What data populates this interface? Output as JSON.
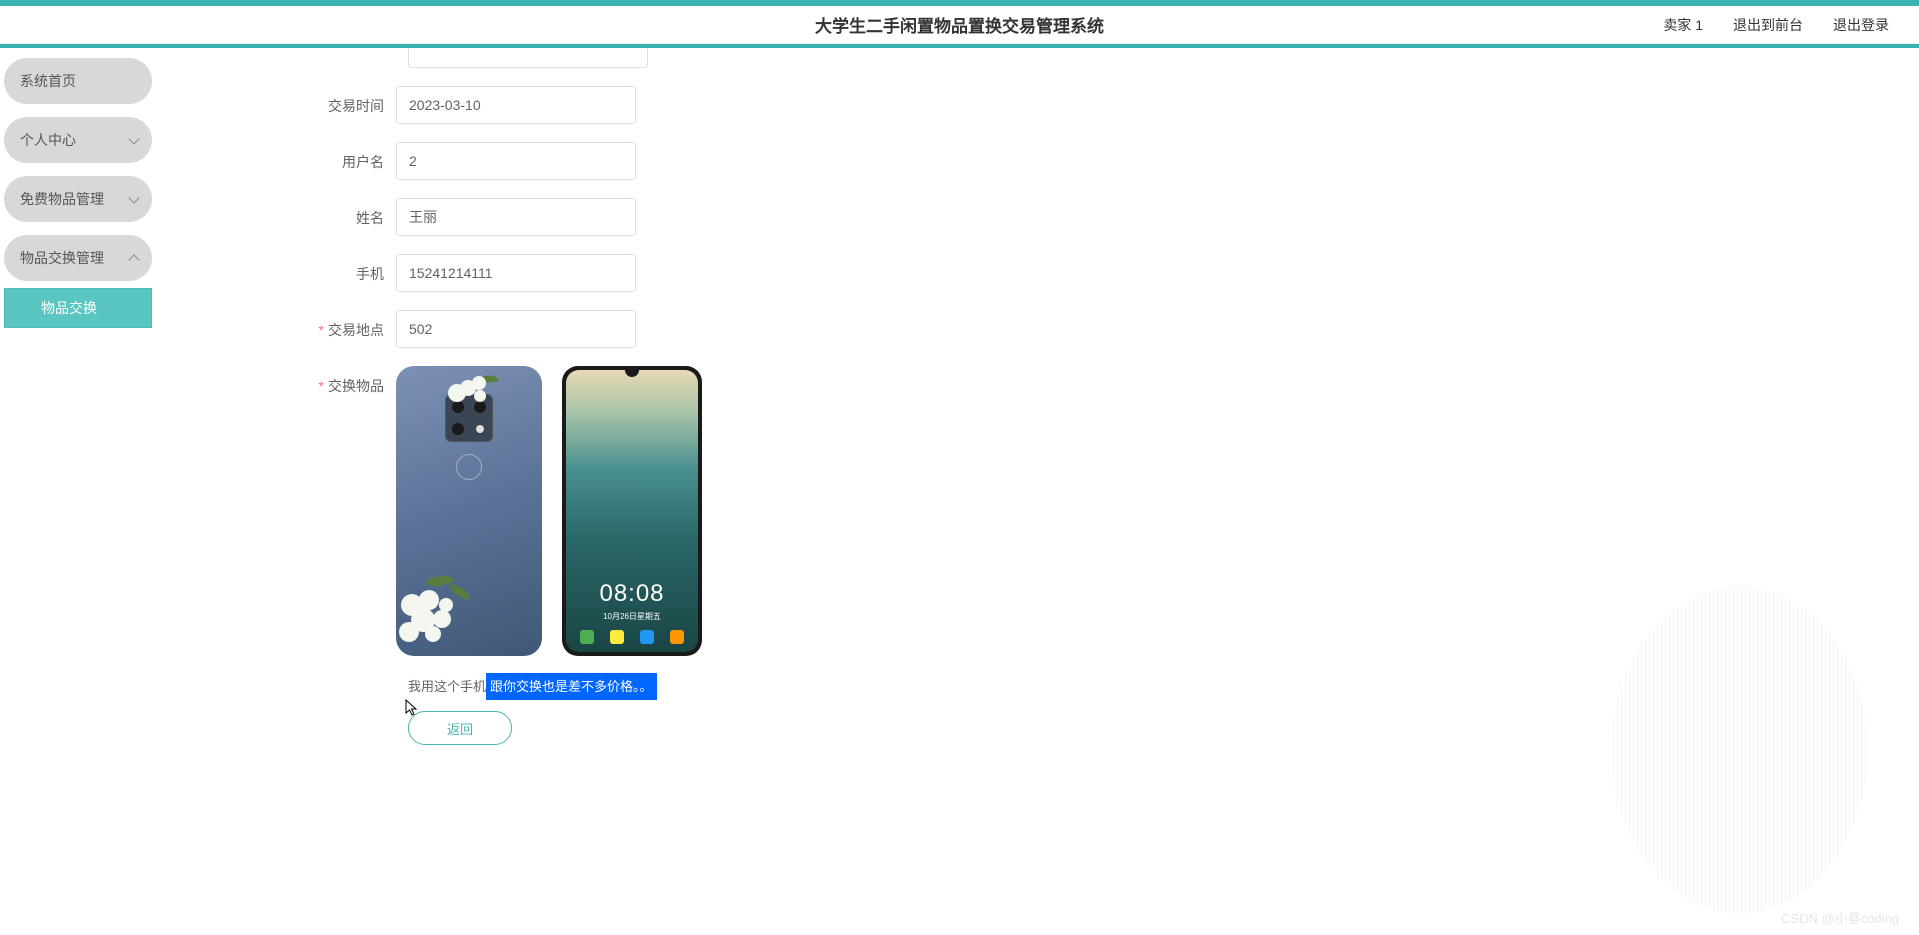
{
  "header": {
    "title": "大学生二手闲置物品置换交易管理系统",
    "user": "卖家 1",
    "exit_front": "退出到前台",
    "logout": "退出登录"
  },
  "sidebar": {
    "home": "系统首页",
    "personal": "个人中心",
    "free_goods": "免费物品管理",
    "exchange_mgmt": "物品交换管理",
    "exchange_sub": "物品交换"
  },
  "form": {
    "trade_time_label": "交易时间",
    "trade_time_value": "2023-03-10",
    "username_label": "用户名",
    "username_value": "2",
    "name_label": "姓名",
    "name_value": "王丽",
    "phone_label": "手机",
    "phone_value": "15241214111",
    "location_label": "交易地点",
    "location_value": "502",
    "exchange_item_label": "交换物品"
  },
  "phone": {
    "time": "08:08",
    "date": "10月26日星期五"
  },
  "message": {
    "prefix": "我用这个手机",
    "highlighted": "跟你交换也是差不多价格。。"
  },
  "buttons": {
    "return": "返回"
  },
  "watermark": "CSDN @小蔡coding"
}
